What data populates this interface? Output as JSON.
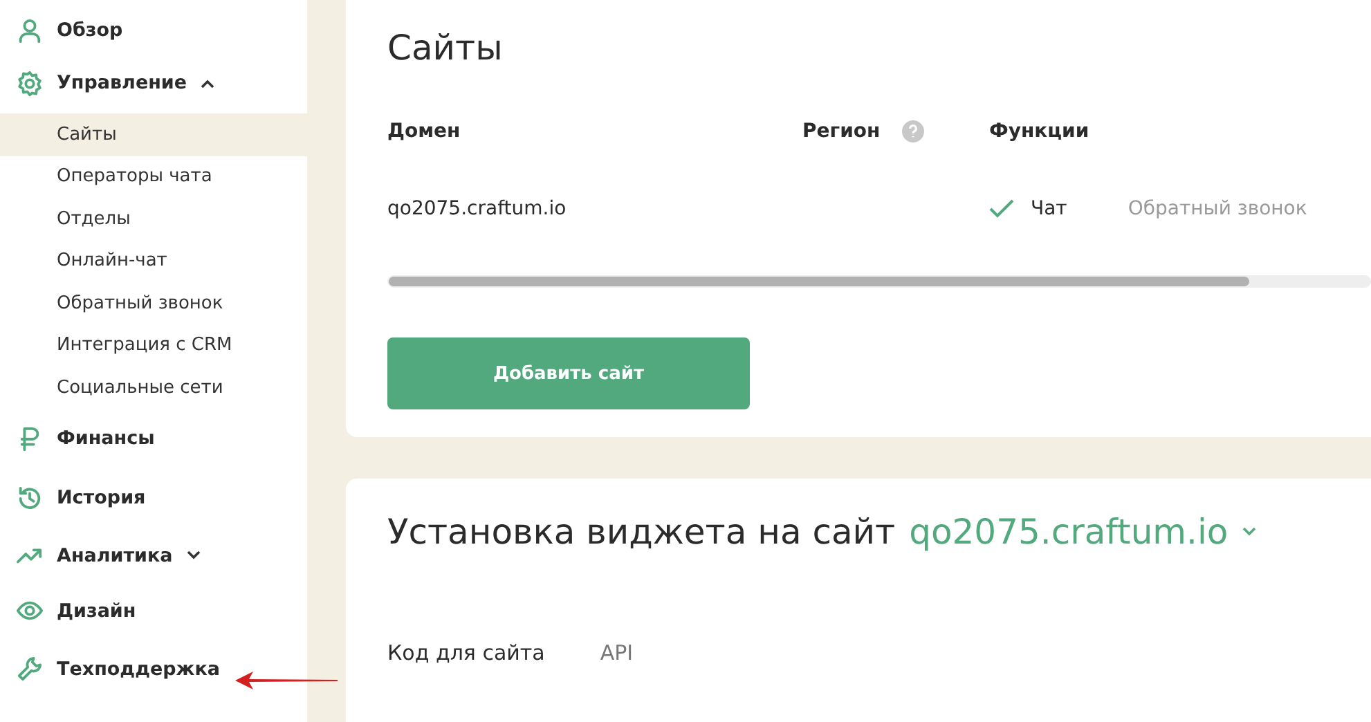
{
  "sidebar": {
    "items": [
      {
        "kind": "item",
        "label": "Обзор"
      },
      {
        "kind": "group",
        "label": "Управление",
        "expanded": true,
        "children": [
          {
            "label": "Сайты",
            "selected": true
          },
          {
            "label": "Операторы чата",
            "selected": false
          },
          {
            "label": "Отделы",
            "selected": false
          },
          {
            "label": "Онлайн-чат",
            "selected": false
          },
          {
            "label": "Обратный звонок",
            "selected": false
          },
          {
            "label": "Интеграция с CRM",
            "selected": false
          },
          {
            "label": "Социальные сети",
            "selected": false
          }
        ]
      },
      {
        "kind": "item",
        "label": "Финансы"
      },
      {
        "kind": "item",
        "label": "История"
      },
      {
        "kind": "group",
        "label": "Аналитика",
        "expanded": false
      },
      {
        "kind": "item",
        "label": "Дизайн"
      },
      {
        "kind": "item",
        "label": "Техподдержка",
        "pointed": true
      }
    ]
  },
  "sites": {
    "title": "Сайты",
    "columns": [
      "Домен",
      "Регион",
      "Функции"
    ],
    "rows": [
      {
        "domain": "qo2075.craftum.io",
        "features": [
          {
            "label": "Чат",
            "enabled": true
          },
          {
            "label": "Обратный звонок",
            "enabled": false
          }
        ]
      }
    ],
    "add_button": "Добавить сайт"
  },
  "widget": {
    "title": "Установка виджета на сайт",
    "site": "qo2075.craftum.io",
    "tabs": [
      {
        "label": "Код для сайта",
        "selected": true
      },
      {
        "label": "API",
        "selected": false
      }
    ]
  }
}
